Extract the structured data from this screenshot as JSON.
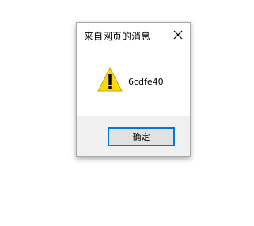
{
  "dialog": {
    "title": "来自网页的消息",
    "message": "6cdfe40",
    "ok_label": "确定",
    "close_icon": "close-icon",
    "message_icon": "warning-icon"
  },
  "colors": {
    "accent": "#0078d7",
    "footer_bg": "#f0f0f0",
    "warning_fill": "#ffd800",
    "button_bg": "#e1e1e1"
  }
}
